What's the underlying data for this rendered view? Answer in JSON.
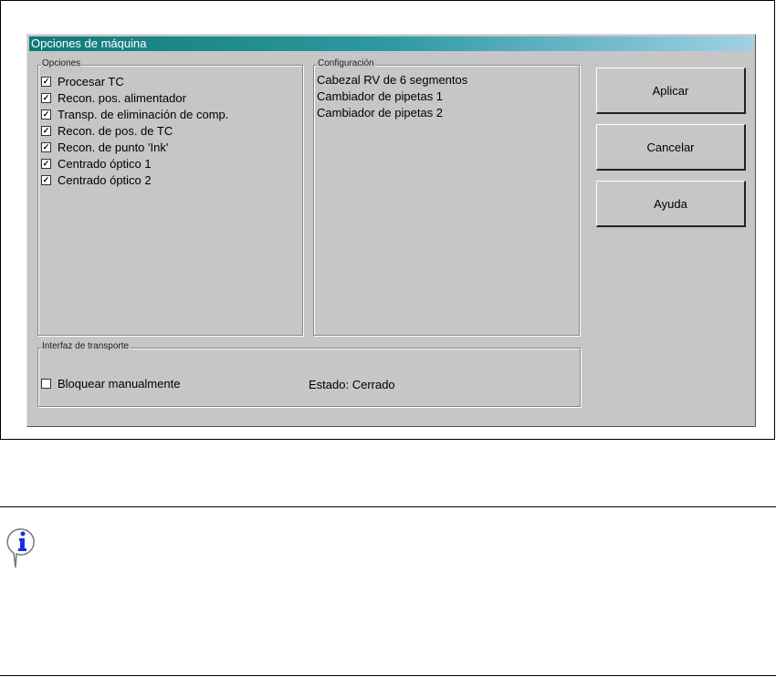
{
  "dialog": {
    "title": "Opciones de máquina"
  },
  "options": {
    "legend": "Opciones",
    "items": [
      {
        "label": "Procesar TC",
        "checked": true
      },
      {
        "label": "Recon. pos. alimentador",
        "checked": true
      },
      {
        "label": "Transp. de eliminación de comp.",
        "checked": true
      },
      {
        "label": "Recon. de pos. de TC",
        "checked": true
      },
      {
        "label": "Recon. de punto 'Ink'",
        "checked": true
      },
      {
        "label": "Centrado óptico 1",
        "checked": true
      },
      {
        "label": "Centrado óptico 2",
        "checked": true
      }
    ]
  },
  "config": {
    "legend": "Configuración",
    "items": [
      "Cabezal RV de 6 segmentos",
      "Cambiador de pipetas 1",
      "Cambiador de pipetas 2"
    ]
  },
  "buttons": {
    "apply": "Aplicar",
    "cancel": "Cancelar",
    "help": "Ayuda"
  },
  "transport": {
    "legend": "Interfaz de transporte",
    "lock_label": "Bloquear manualmente",
    "lock_checked": false,
    "status": "Estado: Cerrado"
  }
}
